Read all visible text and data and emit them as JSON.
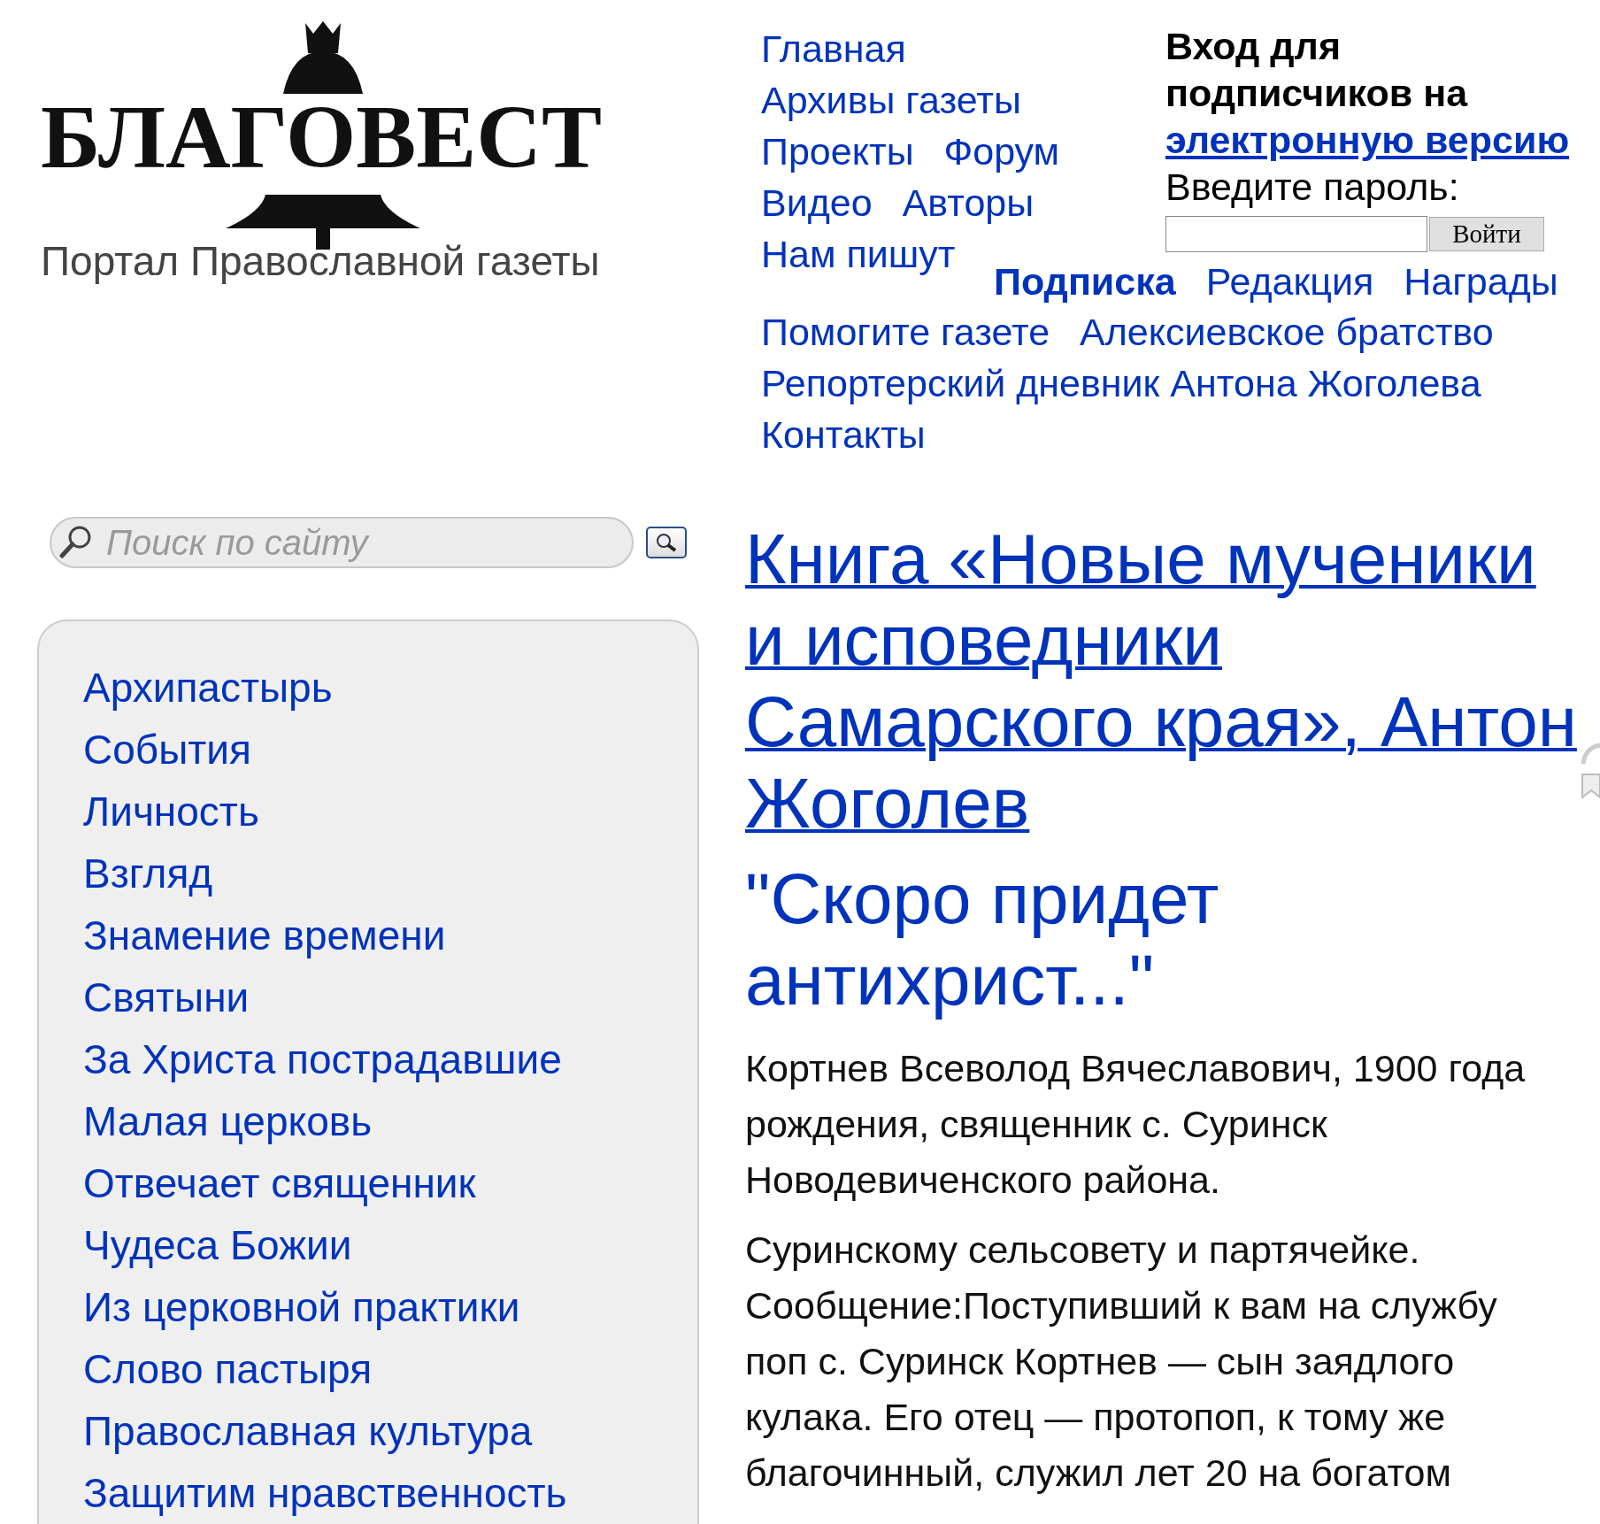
{
  "logo": {
    "title": "БЛАГОВЕСТ",
    "tagline": "Портал Православной газеты"
  },
  "nav": {
    "rows": [
      [
        {
          "label": "Главная",
          "emphasized": false
        }
      ],
      [
        {
          "label": "Архивы газеты",
          "emphasized": false
        }
      ],
      [
        {
          "label": "Проекты",
          "emphasized": false
        },
        {
          "label": "Форум",
          "emphasized": false
        }
      ],
      [
        {
          "label": "Видео",
          "emphasized": false
        },
        {
          "label": "Авторы",
          "emphasized": false
        }
      ],
      [
        {
          "label": "Нам пишут",
          "emphasized": false
        }
      ]
    ],
    "side_row": [
      {
        "label": "Подписка",
        "emphasized": true
      },
      {
        "label": "Редакция",
        "emphasized": false
      },
      {
        "label": "Награды",
        "emphasized": false
      }
    ],
    "bottom_rows": [
      [
        {
          "label": "Помогите газете",
          "emphasized": false
        },
        {
          "label": "Алексиевское братство",
          "emphasized": false
        }
      ],
      [
        {
          "label": "Репортерский дневник Антона Жоголева",
          "emphasized": false
        }
      ],
      [
        {
          "label": "Контакты",
          "emphasized": false
        }
      ]
    ]
  },
  "login": {
    "heading": "Вход для подписчиков на",
    "link": "электронную версию",
    "prompt": "Введите пароль:",
    "button": "Войти"
  },
  "search": {
    "placeholder": "Поиск по сайту"
  },
  "sidebar": {
    "items": [
      "Архипастырь",
      "События",
      "Личность",
      "Взгляд",
      "Знамение времени",
      "Святыни",
      "За Христа пострадавшие",
      "Малая церковь",
      "Отвечает священник",
      "Чудеса Божии",
      "Из церковной практики",
      "Слово пастыря",
      "Православная культура",
      "Защитим нравственность"
    ]
  },
  "article": {
    "title": "Книга «Новые мученики и исповедники Самарского края», Антон Жоголев",
    "subtitle": "\"Скоро придет антихрист...\"",
    "paragraphs": [
      "Кортнев Всеволод Вячеславович, 1900 года рождения, священник с. Суринск Новодевиченского района.",
      "Суринскому сельсовету и партячейке. Сообщение:Поступивший к вам на службу поп с. Суринск Кортнев — сын заядлого кулака. Его отец — протопоп, к тому же благочинный, служил лет 20 на богатом"
    ]
  }
}
